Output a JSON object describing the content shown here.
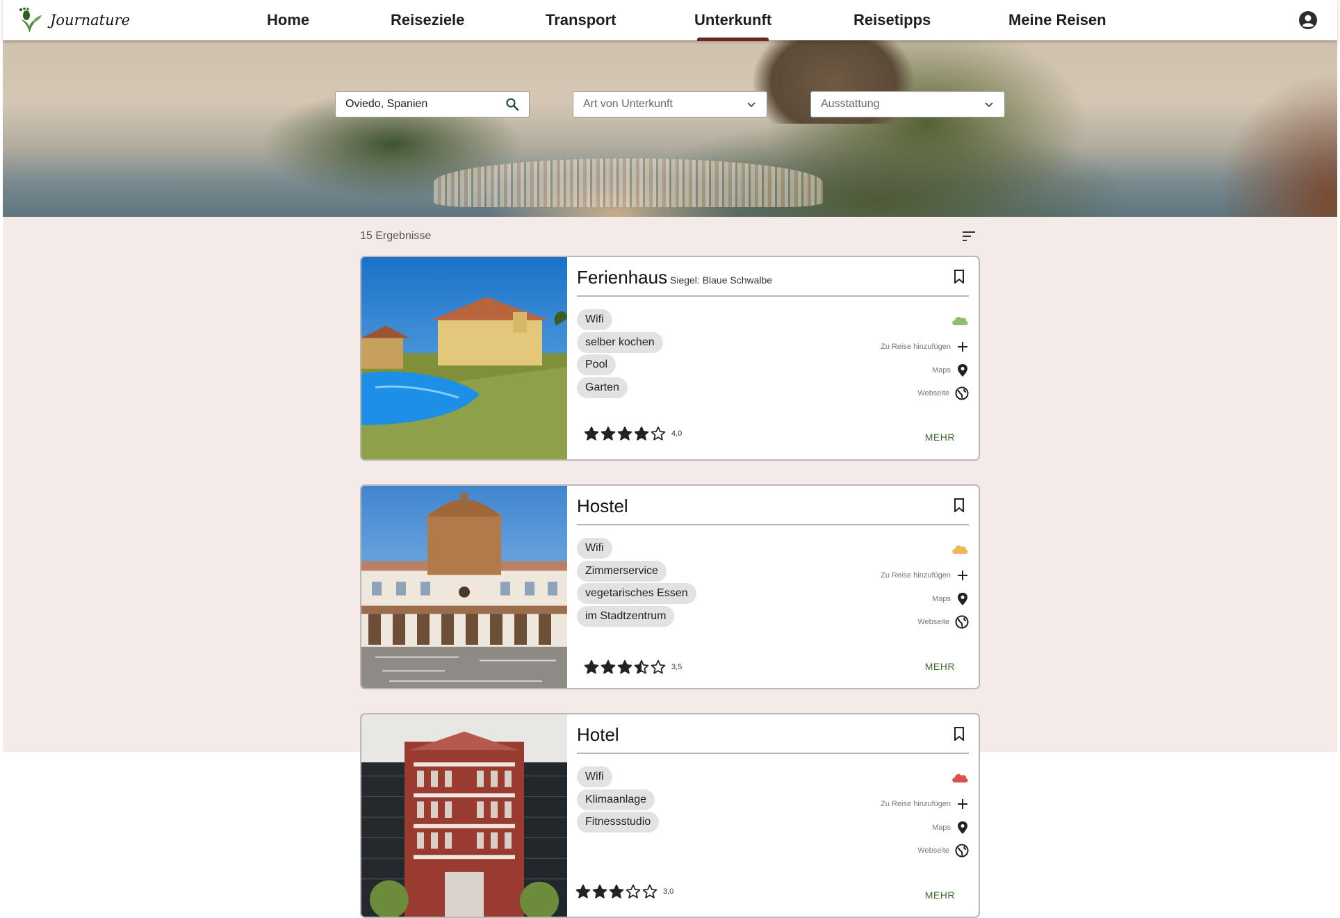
{
  "app": {
    "logo_text": "Journature"
  },
  "nav": {
    "items": [
      {
        "label": "Home"
      },
      {
        "label": "Reiseziele"
      },
      {
        "label": "Transport"
      },
      {
        "label": "Unterkunft",
        "active": true
      },
      {
        "label": "Reisetipps"
      },
      {
        "label": "Meine Reisen"
      }
    ]
  },
  "filters": {
    "location": {
      "value": "Oviedo, Spanien"
    },
    "type": {
      "placeholder": "Art von Unterkunft"
    },
    "amenities": {
      "placeholder": "Ausstattung"
    }
  },
  "results": {
    "count_text": "15 Ergebnisse",
    "cards": [
      {
        "title": "Ferienhaus",
        "seal": "Siegel: Blaue Schwalbe",
        "chips": [
          "Wifi",
          "selber kochen",
          "Pool",
          "Garten"
        ],
        "cloud_color": "#8cbf74",
        "add_label": "Zu Reise hinzufügen",
        "maps_label": "Maps",
        "website_label": "Webseite",
        "stars": 4.0,
        "rating_text": "4,0",
        "more_label": "MEHR"
      },
      {
        "title": "Hostel",
        "seal": "",
        "chips": [
          "Wifi",
          "Zimmerservice",
          "vegetarisches Essen",
          "im Stadtzentrum"
        ],
        "cloud_color": "#f3b65b",
        "add_label": "Zu Reise hinzufügen",
        "maps_label": "Maps",
        "website_label": "Webseite",
        "stars": 3.5,
        "rating_text": "3,5",
        "more_label": "MEHR"
      },
      {
        "title": "Hotel",
        "seal": "",
        "chips": [
          "Wifi",
          "Klimaanlage",
          "Fitnessstudio"
        ],
        "cloud_color": "#d9534c",
        "add_label": "Zu Reise hinzufügen",
        "maps_label": "Maps",
        "website_label": "Webseite",
        "stars": 3.0,
        "rating_text": "3,0",
        "more_label": "MEHR"
      }
    ]
  },
  "colors": {
    "accent": "#6b2620",
    "more_link": "#3b6a2a",
    "results_bg": "#f4ebe8"
  }
}
